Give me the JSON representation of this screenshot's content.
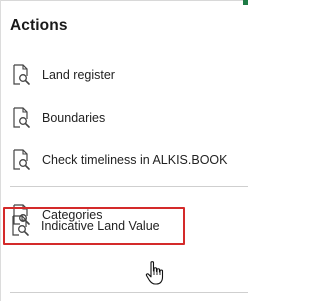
{
  "panel": {
    "title": "Actions"
  },
  "items": [
    {
      "label": "Land register",
      "icon": "document-search-icon"
    },
    {
      "label": "Boundaries",
      "icon": "document-search-icon"
    },
    {
      "label": "Check timeliness in ALKIS.BOOK",
      "icon": "document-search-icon"
    },
    {
      "label": "Categories",
      "icon": "document-search-icon"
    },
    {
      "label": "Indicative Land Value",
      "icon": "document-search-icon",
      "highlighted": true
    }
  ],
  "colors": {
    "highlight_border": "#d42a2a",
    "accent": "#1e7b45",
    "divider": "#cfcfcf"
  },
  "cursor": {
    "icon": "hand-pointer-icon"
  }
}
